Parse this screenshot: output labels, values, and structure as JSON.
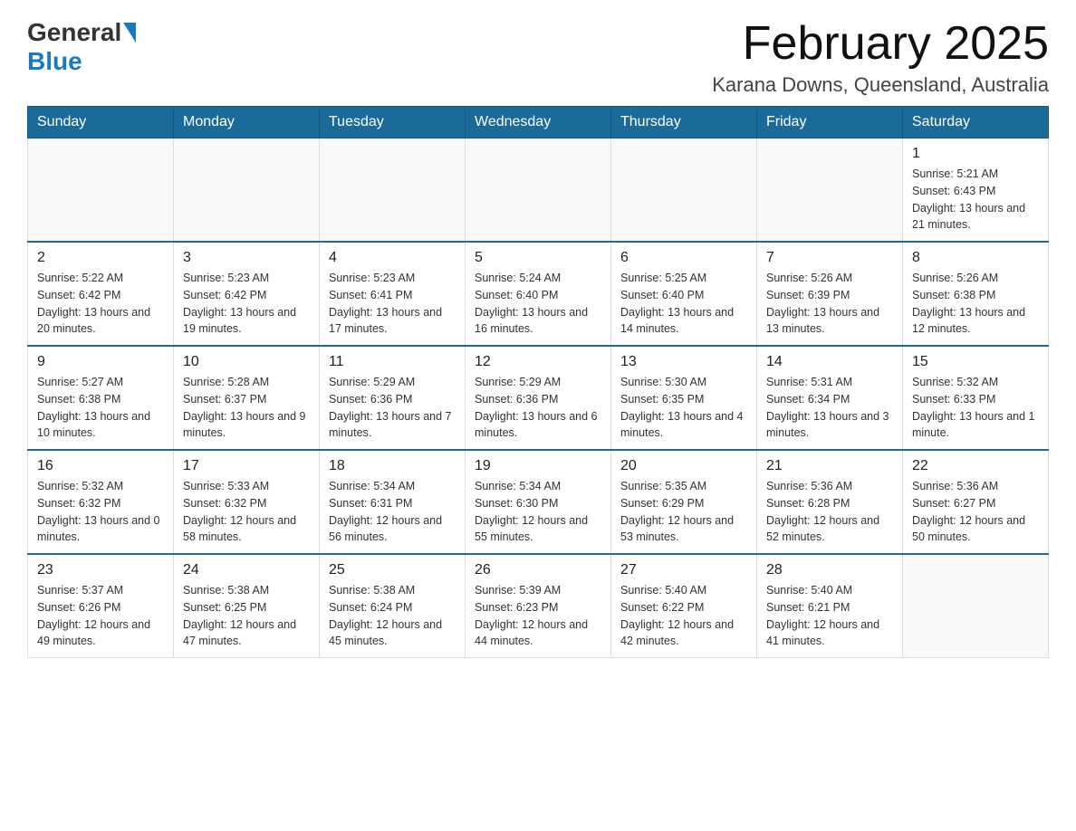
{
  "header": {
    "logo_general": "General",
    "logo_blue": "Blue",
    "title": "February 2025",
    "subtitle": "Karana Downs, Queensland, Australia"
  },
  "days_of_week": [
    "Sunday",
    "Monday",
    "Tuesday",
    "Wednesday",
    "Thursday",
    "Friday",
    "Saturday"
  ],
  "weeks": [
    [
      {
        "day": "",
        "info": ""
      },
      {
        "day": "",
        "info": ""
      },
      {
        "day": "",
        "info": ""
      },
      {
        "day": "",
        "info": ""
      },
      {
        "day": "",
        "info": ""
      },
      {
        "day": "",
        "info": ""
      },
      {
        "day": "1",
        "info": "Sunrise: 5:21 AM\nSunset: 6:43 PM\nDaylight: 13 hours and 21 minutes."
      }
    ],
    [
      {
        "day": "2",
        "info": "Sunrise: 5:22 AM\nSunset: 6:42 PM\nDaylight: 13 hours and 20 minutes."
      },
      {
        "day": "3",
        "info": "Sunrise: 5:23 AM\nSunset: 6:42 PM\nDaylight: 13 hours and 19 minutes."
      },
      {
        "day": "4",
        "info": "Sunrise: 5:23 AM\nSunset: 6:41 PM\nDaylight: 13 hours and 17 minutes."
      },
      {
        "day": "5",
        "info": "Sunrise: 5:24 AM\nSunset: 6:40 PM\nDaylight: 13 hours and 16 minutes."
      },
      {
        "day": "6",
        "info": "Sunrise: 5:25 AM\nSunset: 6:40 PM\nDaylight: 13 hours and 14 minutes."
      },
      {
        "day": "7",
        "info": "Sunrise: 5:26 AM\nSunset: 6:39 PM\nDaylight: 13 hours and 13 minutes."
      },
      {
        "day": "8",
        "info": "Sunrise: 5:26 AM\nSunset: 6:38 PM\nDaylight: 13 hours and 12 minutes."
      }
    ],
    [
      {
        "day": "9",
        "info": "Sunrise: 5:27 AM\nSunset: 6:38 PM\nDaylight: 13 hours and 10 minutes."
      },
      {
        "day": "10",
        "info": "Sunrise: 5:28 AM\nSunset: 6:37 PM\nDaylight: 13 hours and 9 minutes."
      },
      {
        "day": "11",
        "info": "Sunrise: 5:29 AM\nSunset: 6:36 PM\nDaylight: 13 hours and 7 minutes."
      },
      {
        "day": "12",
        "info": "Sunrise: 5:29 AM\nSunset: 6:36 PM\nDaylight: 13 hours and 6 minutes."
      },
      {
        "day": "13",
        "info": "Sunrise: 5:30 AM\nSunset: 6:35 PM\nDaylight: 13 hours and 4 minutes."
      },
      {
        "day": "14",
        "info": "Sunrise: 5:31 AM\nSunset: 6:34 PM\nDaylight: 13 hours and 3 minutes."
      },
      {
        "day": "15",
        "info": "Sunrise: 5:32 AM\nSunset: 6:33 PM\nDaylight: 13 hours and 1 minute."
      }
    ],
    [
      {
        "day": "16",
        "info": "Sunrise: 5:32 AM\nSunset: 6:32 PM\nDaylight: 13 hours and 0 minutes."
      },
      {
        "day": "17",
        "info": "Sunrise: 5:33 AM\nSunset: 6:32 PM\nDaylight: 12 hours and 58 minutes."
      },
      {
        "day": "18",
        "info": "Sunrise: 5:34 AM\nSunset: 6:31 PM\nDaylight: 12 hours and 56 minutes."
      },
      {
        "day": "19",
        "info": "Sunrise: 5:34 AM\nSunset: 6:30 PM\nDaylight: 12 hours and 55 minutes."
      },
      {
        "day": "20",
        "info": "Sunrise: 5:35 AM\nSunset: 6:29 PM\nDaylight: 12 hours and 53 minutes."
      },
      {
        "day": "21",
        "info": "Sunrise: 5:36 AM\nSunset: 6:28 PM\nDaylight: 12 hours and 52 minutes."
      },
      {
        "day": "22",
        "info": "Sunrise: 5:36 AM\nSunset: 6:27 PM\nDaylight: 12 hours and 50 minutes."
      }
    ],
    [
      {
        "day": "23",
        "info": "Sunrise: 5:37 AM\nSunset: 6:26 PM\nDaylight: 12 hours and 49 minutes."
      },
      {
        "day": "24",
        "info": "Sunrise: 5:38 AM\nSunset: 6:25 PM\nDaylight: 12 hours and 47 minutes."
      },
      {
        "day": "25",
        "info": "Sunrise: 5:38 AM\nSunset: 6:24 PM\nDaylight: 12 hours and 45 minutes."
      },
      {
        "day": "26",
        "info": "Sunrise: 5:39 AM\nSunset: 6:23 PM\nDaylight: 12 hours and 44 minutes."
      },
      {
        "day": "27",
        "info": "Sunrise: 5:40 AM\nSunset: 6:22 PM\nDaylight: 12 hours and 42 minutes."
      },
      {
        "day": "28",
        "info": "Sunrise: 5:40 AM\nSunset: 6:21 PM\nDaylight: 12 hours and 41 minutes."
      },
      {
        "day": "",
        "info": ""
      }
    ]
  ]
}
